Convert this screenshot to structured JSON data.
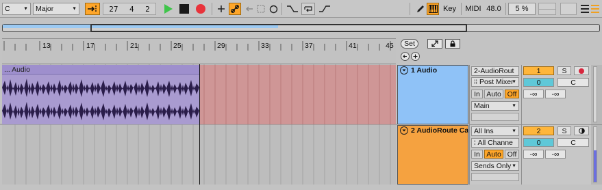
{
  "toolbar": {
    "key_value": "C",
    "scale_value": "Major",
    "position": [
      "27",
      "4",
      "2"
    ],
    "key_label": "Key",
    "midi_label": "MIDI",
    "cpu_value": "48.0",
    "zoom_value": "5 %"
  },
  "ruler": {
    "bars": [
      "13",
      "17",
      "21",
      "25",
      "29",
      "33",
      "37",
      "41",
      "45"
    ],
    "set_label": "Set"
  },
  "clip": {
    "title": "... Audio"
  },
  "tracks": [
    {
      "name": "1 Audio",
      "color": "#8fc2f7",
      "input_type": "2-AudioRout",
      "input_channel": "Post Mixer",
      "monitor": [
        "In",
        "Auto",
        "Off"
      ],
      "output": "Main",
      "number": "1",
      "solo": "S",
      "volume": "0",
      "pan": "C",
      "send_a": "-∞",
      "send_b": "-∞"
    },
    {
      "name": "2 AudioRoute Ca",
      "color": "#f5a240",
      "input_type": "All Ins",
      "input_channel": "All Channe",
      "monitor": [
        "In",
        "Auto",
        "Off"
      ],
      "output": "Sends Only",
      "number": "2",
      "solo": "S",
      "volume": "0",
      "pan": "C",
      "send_a": "-∞",
      "send_b": "-∞"
    }
  ]
}
